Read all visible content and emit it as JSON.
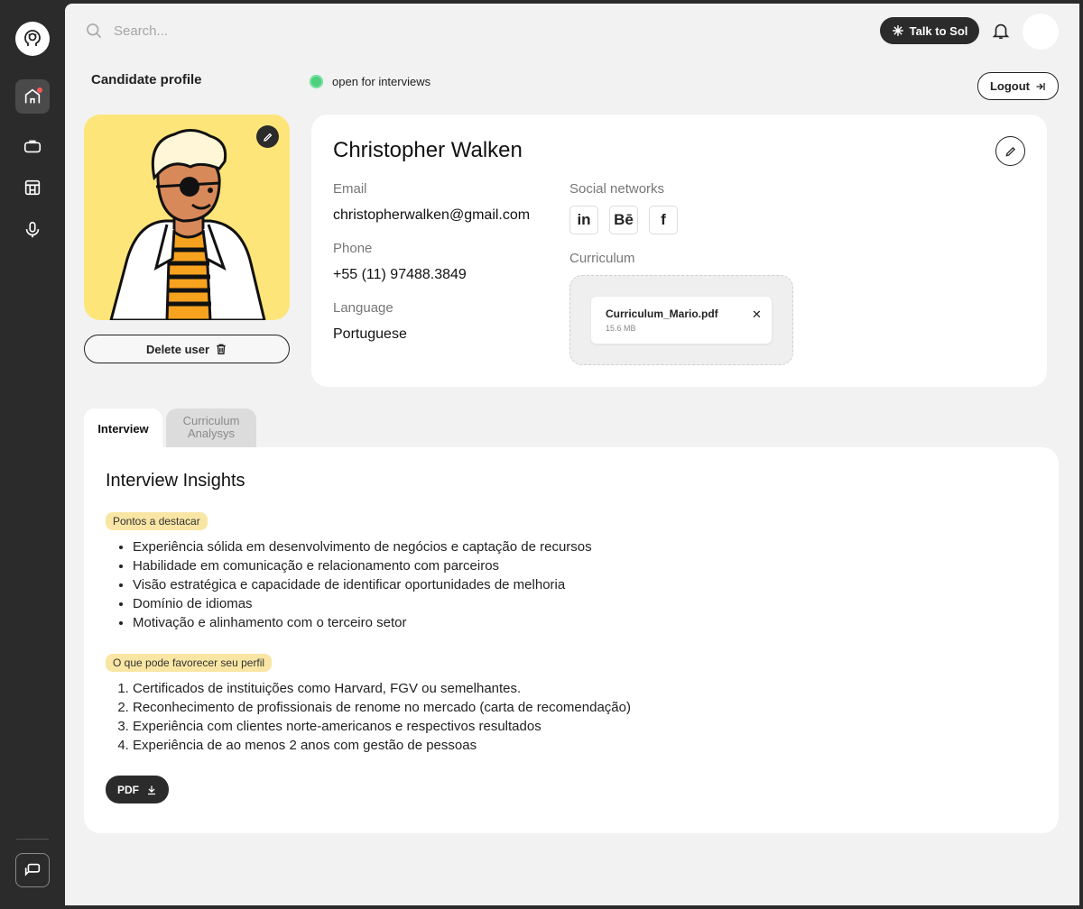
{
  "topbar": {
    "search_placeholder": "Search...",
    "talk_label": "Talk to Sol"
  },
  "header": {
    "page_title": "Candidate profile",
    "status_text": "open for interviews",
    "logout_label": "Logout"
  },
  "profile": {
    "delete_label": "Delete user",
    "name": "Christopher Walken",
    "email_label": "Email",
    "email": "christopherwalken@gmail.com",
    "phone_label": "Phone",
    "phone": "+55 (11) 97488.3849",
    "language_label": "Language",
    "language": "Portuguese",
    "social_label": "Social networks",
    "social": [
      "in",
      "Bē",
      "f"
    ],
    "curriculum_label": "Curriculum",
    "file_name": "Curriculum_Mario.pdf",
    "file_size": "15.6 MB"
  },
  "tabs": [
    {
      "label": "Interview"
    },
    {
      "label": "Curriculum Analysys"
    }
  ],
  "insights": {
    "title": "Interview Insights",
    "highlights_tag": "Pontos a destacar",
    "highlights": [
      "Experiência sólida em desenvolvimento de negócios e captação de recursos",
      "Habilidade em comunicação e relacionamento com parceiros",
      "Visão estratégica e capacidade de identificar oportunidades de melhoria",
      "Domínio de idiomas",
      "Motivação e alinhamento com o terceiro setor"
    ],
    "improve_tag": "O que pode favorecer seu perfil",
    "improve": [
      "Certificados de instituições como Harvard, FGV ou semelhantes.",
      "Reconhecimento de profissionais de renome no mercado (carta de recomendação)",
      "Experiência com clientes norte-americanos e respectivos resultados",
      "Experiência de ao menos 2 anos com gestão de pessoas"
    ],
    "pdf_label": "PDF"
  },
  "colors": {
    "status_green": "#4cd07d",
    "photo_bg": "#fde57a",
    "tag_bg": "#f9e6a4",
    "dark": "#2b2b2b"
  }
}
